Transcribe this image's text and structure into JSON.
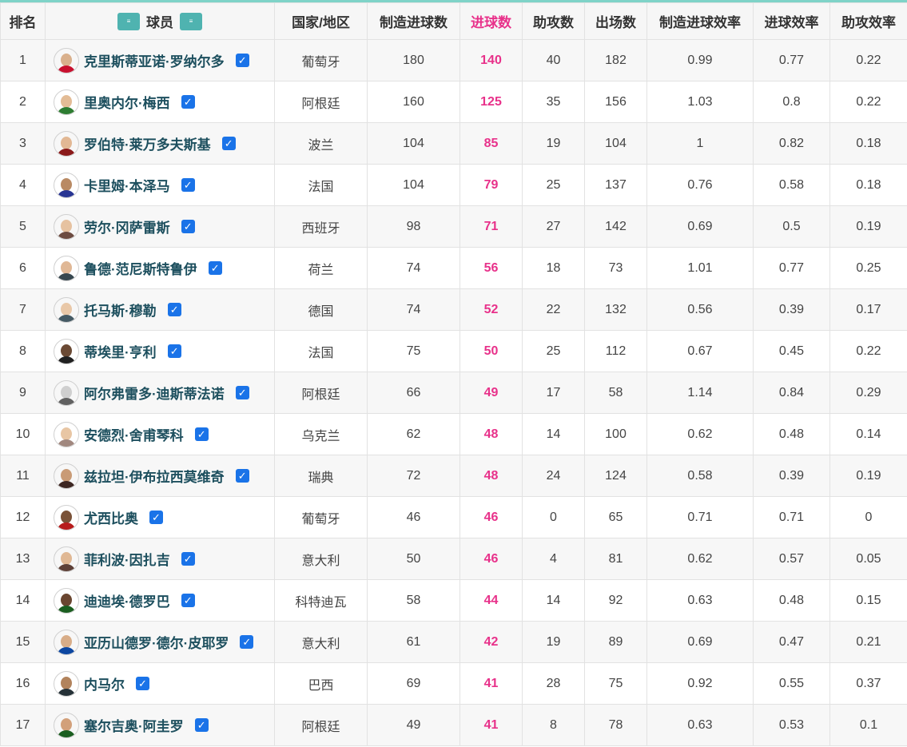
{
  "headers": {
    "rank": "排名",
    "player": "球员",
    "country": "国家/地区",
    "created": "制造进球数",
    "goals": "进球数",
    "assists": "助攻数",
    "apps": "出场数",
    "created_eff": "制造进球效率",
    "goal_eff": "进球效率",
    "assist_eff": "助攻效率"
  },
  "colors": {
    "accent": "#e8318a",
    "player_name": "#1d4f5e",
    "check": "#1a73e8",
    "topbar": "#7fd3c8"
  },
  "rows": [
    {
      "rank": "1",
      "name": "克里斯蒂亚诺·罗纳尔多",
      "country": "葡萄牙",
      "created": "180",
      "goals": "140",
      "assists": "40",
      "apps": "182",
      "created_eff": "0.99",
      "goal_eff": "0.77",
      "assist_eff": "0.22"
    },
    {
      "rank": "2",
      "name": "里奥内尔·梅西",
      "country": "阿根廷",
      "created": "160",
      "goals": "125",
      "assists": "35",
      "apps": "156",
      "created_eff": "1.03",
      "goal_eff": "0.8",
      "assist_eff": "0.22"
    },
    {
      "rank": "3",
      "name": "罗伯特·莱万多夫斯基",
      "country": "波兰",
      "created": "104",
      "goals": "85",
      "assists": "19",
      "apps": "104",
      "created_eff": "1",
      "goal_eff": "0.82",
      "assist_eff": "0.18"
    },
    {
      "rank": "4",
      "name": "卡里姆·本泽马",
      "country": "法国",
      "created": "104",
      "goals": "79",
      "assists": "25",
      "apps": "137",
      "created_eff": "0.76",
      "goal_eff": "0.58",
      "assist_eff": "0.18"
    },
    {
      "rank": "5",
      "name": "劳尔·冈萨雷斯",
      "country": "西班牙",
      "created": "98",
      "goals": "71",
      "assists": "27",
      "apps": "142",
      "created_eff": "0.69",
      "goal_eff": "0.5",
      "assist_eff": "0.19"
    },
    {
      "rank": "6",
      "name": "鲁德·范尼斯特鲁伊",
      "country": "荷兰",
      "created": "74",
      "goals": "56",
      "assists": "18",
      "apps": "73",
      "created_eff": "1.01",
      "goal_eff": "0.77",
      "assist_eff": "0.25"
    },
    {
      "rank": "7",
      "name": "托马斯·穆勒",
      "country": "德国",
      "created": "74",
      "goals": "52",
      "assists": "22",
      "apps": "132",
      "created_eff": "0.56",
      "goal_eff": "0.39",
      "assist_eff": "0.17"
    },
    {
      "rank": "8",
      "name": "蒂埃里·亨利",
      "country": "法国",
      "created": "75",
      "goals": "50",
      "assists": "25",
      "apps": "112",
      "created_eff": "0.67",
      "goal_eff": "0.45",
      "assist_eff": "0.22"
    },
    {
      "rank": "9",
      "name": "阿尔弗雷多·迪斯蒂法诺",
      "country": "阿根廷",
      "created": "66",
      "goals": "49",
      "assists": "17",
      "apps": "58",
      "created_eff": "1.14",
      "goal_eff": "0.84",
      "assist_eff": "0.29"
    },
    {
      "rank": "10",
      "name": "安德烈·舍甫琴科",
      "country": "乌克兰",
      "created": "62",
      "goals": "48",
      "assists": "14",
      "apps": "100",
      "created_eff": "0.62",
      "goal_eff": "0.48",
      "assist_eff": "0.14"
    },
    {
      "rank": "11",
      "name": "兹拉坦·伊布拉西莫维奇",
      "country": "瑞典",
      "created": "72",
      "goals": "48",
      "assists": "24",
      "apps": "124",
      "created_eff": "0.58",
      "goal_eff": "0.39",
      "assist_eff": "0.19"
    },
    {
      "rank": "12",
      "name": "尤西比奥",
      "country": "葡萄牙",
      "created": "46",
      "goals": "46",
      "assists": "0",
      "apps": "65",
      "created_eff": "0.71",
      "goal_eff": "0.71",
      "assist_eff": "0"
    },
    {
      "rank": "13",
      "name": "菲利波·因扎吉",
      "country": "意大利",
      "created": "50",
      "goals": "46",
      "assists": "4",
      "apps": "81",
      "created_eff": "0.62",
      "goal_eff": "0.57",
      "assist_eff": "0.05"
    },
    {
      "rank": "14",
      "name": "迪迪埃·德罗巴",
      "country": "科特迪瓦",
      "created": "58",
      "goals": "44",
      "assists": "14",
      "apps": "92",
      "created_eff": "0.63",
      "goal_eff": "0.48",
      "assist_eff": "0.15"
    },
    {
      "rank": "15",
      "name": "亚历山德罗·德尔·皮耶罗",
      "country": "意大利",
      "created": "61",
      "goals": "42",
      "assists": "19",
      "apps": "89",
      "created_eff": "0.69",
      "goal_eff": "0.47",
      "assist_eff": "0.21"
    },
    {
      "rank": "16",
      "name": "内马尔",
      "country": "巴西",
      "created": "69",
      "goals": "41",
      "assists": "28",
      "apps": "75",
      "created_eff": "0.92",
      "goal_eff": "0.55",
      "assist_eff": "0.37"
    },
    {
      "rank": "17",
      "name": "塞尔吉奥·阿圭罗",
      "country": "阿根廷",
      "created": "49",
      "goals": "41",
      "assists": "8",
      "apps": "78",
      "created_eff": "0.63",
      "goal_eff": "0.53",
      "assist_eff": "0.1"
    }
  ]
}
